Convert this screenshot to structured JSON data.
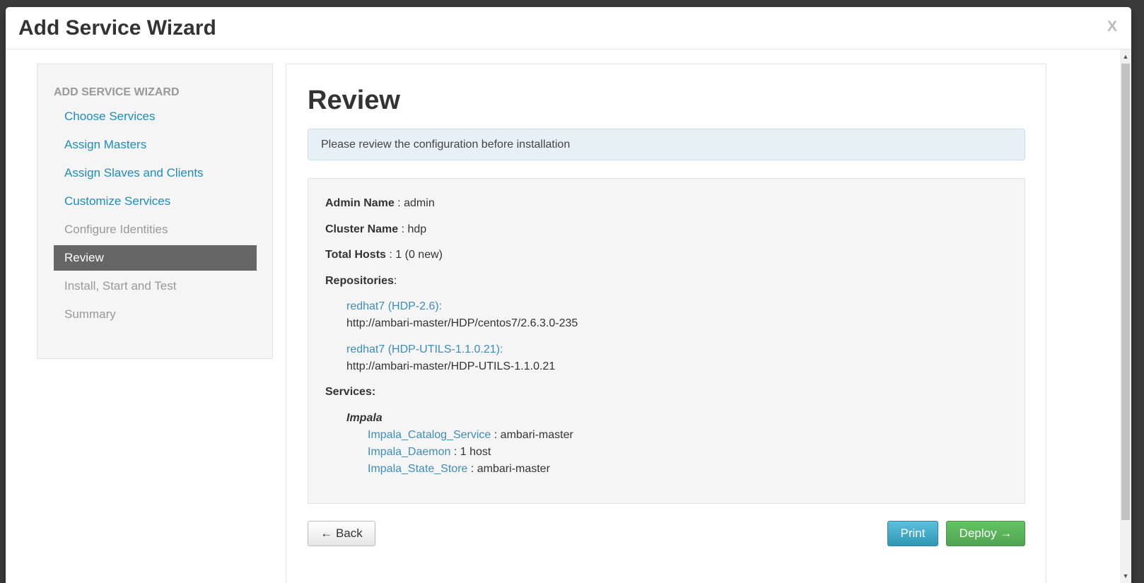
{
  "modal": {
    "title": "Add Service Wizard",
    "close": "X"
  },
  "sidebar": {
    "header": "ADD SERVICE WIZARD",
    "items": [
      {
        "label": "Choose Services",
        "state": "link"
      },
      {
        "label": "Assign Masters",
        "state": "link"
      },
      {
        "label": "Assign Slaves and Clients",
        "state": "link"
      },
      {
        "label": "Customize Services",
        "state": "link"
      },
      {
        "label": "Configure Identities",
        "state": "disabled"
      },
      {
        "label": "Review",
        "state": "active"
      },
      {
        "label": "Install, Start and Test",
        "state": "disabled"
      },
      {
        "label": "Summary",
        "state": "disabled"
      }
    ]
  },
  "main": {
    "title": "Review",
    "alert": "Please review the configuration before installation",
    "admin": {
      "label": "Admin Name",
      "value": " : admin"
    },
    "cluster": {
      "label": "Cluster Name",
      "value": " : hdp"
    },
    "hosts": {
      "label": "Total Hosts",
      "value": " : 1 (0 new)"
    },
    "repositories_label": "Repositories",
    "repositories_colon": ":",
    "repositories": [
      {
        "name": "redhat7 (HDP-2.6):",
        "url": "http://ambari-master/HDP/centos7/2.6.3.0-235"
      },
      {
        "name": "redhat7 (HDP-UTILS-1.1.0.21):",
        "url": "http://ambari-master/HDP-UTILS-1.1.0.21"
      }
    ],
    "services_label": "Services:",
    "service": {
      "name": "Impala",
      "components": [
        {
          "name": "Impala_Catalog_Service",
          "value": " : ambari-master"
        },
        {
          "name": "Impala_Daemon",
          "value": " : 1 host"
        },
        {
          "name": "Impala_State_Store",
          "value": " : ambari-master"
        }
      ]
    }
  },
  "buttons": {
    "back": "← Back",
    "print": "Print",
    "deploy": "Deploy →"
  },
  "colors": {
    "link": "#1f8dbb",
    "active_bg": "#666666",
    "print": "#2f96b4",
    "deploy": "#51a351"
  }
}
